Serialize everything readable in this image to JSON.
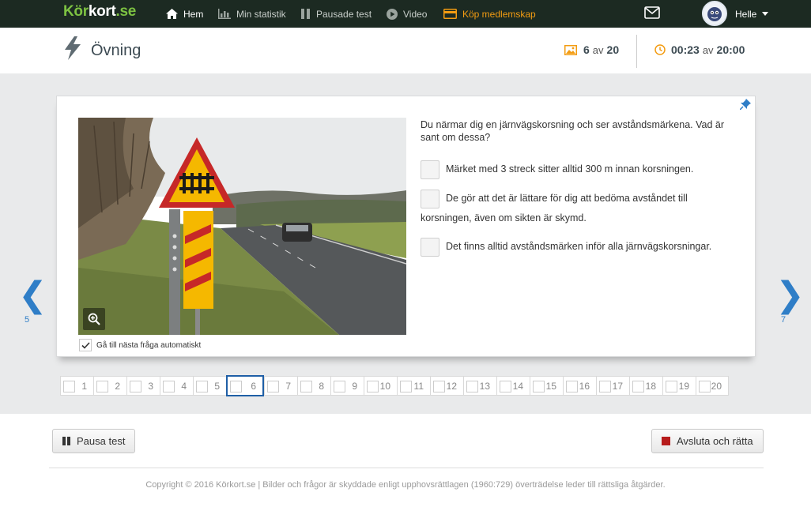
{
  "nav": {
    "logo_part1": "Kör",
    "logo_part2": "kort",
    "logo_part3": ".se",
    "items": [
      {
        "label": "Hem",
        "icon": "home-icon"
      },
      {
        "label": "Min statistik",
        "icon": "bar-chart-icon"
      },
      {
        "label": "Pausade test",
        "icon": "pause-icon"
      },
      {
        "label": "Video",
        "icon": "play-icon"
      },
      {
        "label": "Köp medlemskap",
        "icon": "card-icon"
      }
    ],
    "user": "Helle",
    "accent": "#f39c12",
    "logo_color": "#7dc242"
  },
  "header": {
    "title": "Övning",
    "question_current": "6",
    "question_av": "av",
    "question_total": "20",
    "time_elapsed": "00:23",
    "time_av": "av",
    "time_total": "20:00"
  },
  "question": {
    "text": "Du närmar dig en järnvägskorsning och ser avståndsmärkena. Vad är sant om dessa?",
    "answers": [
      "Märket med 3 streck sitter alltid 300 m innan korsningen.",
      "De gör att det är lättare för dig att bedöma avståndet till korsningen, även om sikten är skymd.",
      "Det finns alltid avståndsmärken inför alla järnvägskorsningar."
    ],
    "auto_next_label": "Gå till nästa fråga automatiskt",
    "auto_next_checked": true
  },
  "navigation": {
    "prev": "5",
    "next": "7",
    "prev_glyph": "❮",
    "next_glyph": "❯"
  },
  "pager": [
    "1",
    "2",
    "3",
    "4",
    "5",
    "6",
    "7",
    "8",
    "9",
    "10",
    "11",
    "12",
    "13",
    "14",
    "15",
    "16",
    "17",
    "18",
    "19",
    "20"
  ],
  "pager_current": "6",
  "buttons": {
    "pause": "Pausa test",
    "finish": "Avsluta och rätta"
  },
  "footer": {
    "copyright": "Copyright © 2016 Körkort.se | Bilder och frågor är skyddade enligt upphovsrättlagen (1960:729) överträdelse leder till rättsliga åtgärder."
  }
}
